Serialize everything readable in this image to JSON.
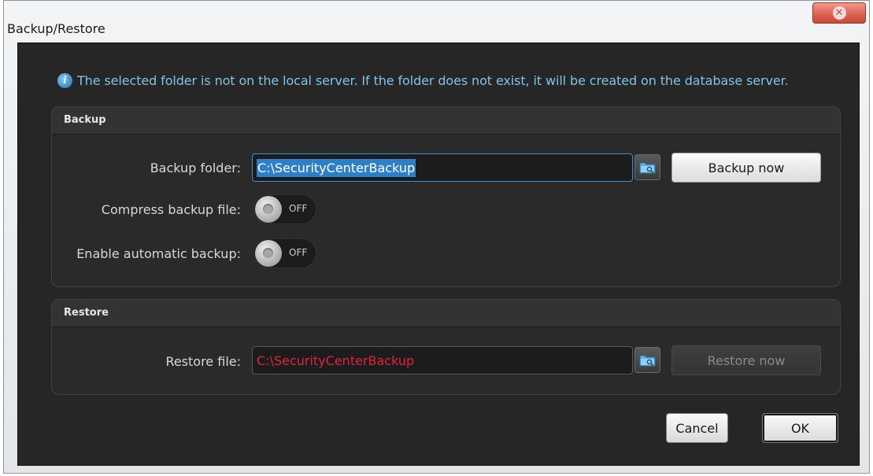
{
  "window": {
    "title": "Backup/Restore",
    "close_icon": "close-icon"
  },
  "info": {
    "icon": "info-icon",
    "message": "The selected folder is not on the local server. If the folder does not exist, it will be created on the database server."
  },
  "backup": {
    "header": "Backup",
    "folder_label": "Backup folder:",
    "folder_value": "C:\\SecurityCenterBackup",
    "browse_icon": "folder-icon",
    "backup_now_label": "Backup now",
    "compress_label": "Compress backup file:",
    "compress_state": "OFF",
    "auto_label": "Enable automatic backup:",
    "auto_state": "OFF"
  },
  "restore": {
    "header": "Restore",
    "file_label": "Restore file:",
    "file_value": "C:\\SecurityCenterBackup",
    "browse_icon": "folder-icon",
    "restore_now_label": "Restore now"
  },
  "footer": {
    "cancel_label": "Cancel",
    "ok_label": "OK"
  },
  "colors": {
    "dialog_bg": "#262626",
    "info_text": "#7fc3ea",
    "selection": "#2f7fc6",
    "error_text": "#e0233f",
    "close_button": "#d9604f"
  }
}
